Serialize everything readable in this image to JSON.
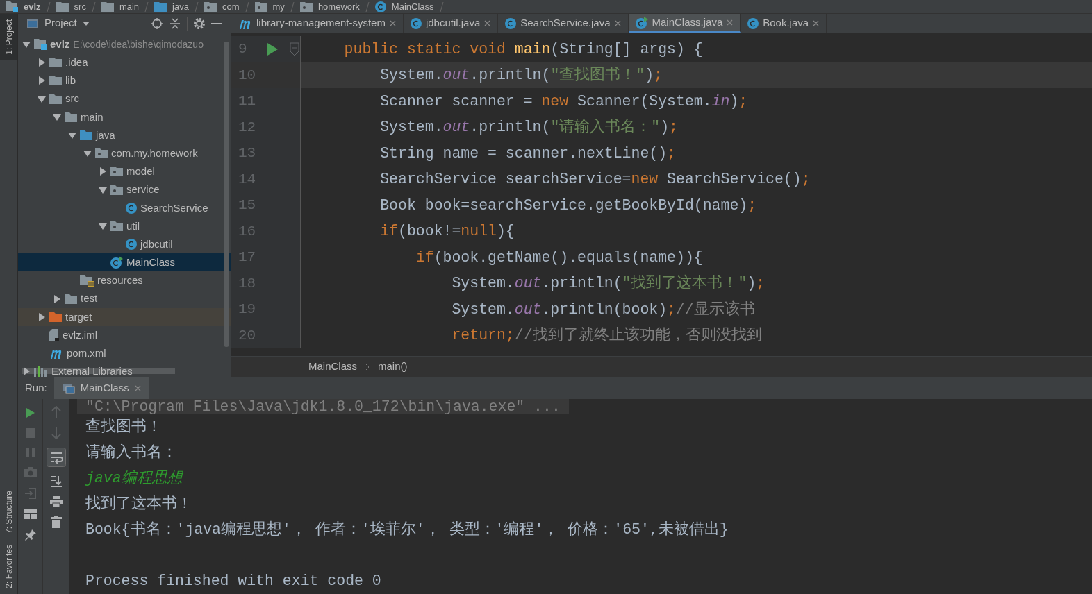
{
  "navbar": [
    {
      "label": "evlz",
      "kind": "module"
    },
    {
      "label": "src",
      "kind": "folder"
    },
    {
      "label": "main",
      "kind": "folder"
    },
    {
      "label": "java",
      "kind": "source"
    },
    {
      "label": "com",
      "kind": "package"
    },
    {
      "label": "my",
      "kind": "package"
    },
    {
      "label": "homework",
      "kind": "package"
    },
    {
      "label": "MainClass",
      "kind": "class"
    }
  ],
  "left_stripe": [
    {
      "label": "1: Project",
      "selected": true
    },
    {
      "label": "7: Structure",
      "selected": false
    },
    {
      "label": "2: Favorites",
      "selected": false
    }
  ],
  "project_panel": {
    "title": "Project",
    "tree": [
      {
        "label": "evlz",
        "path": "E:\\code\\idea\\bishe\\qimodazuo",
        "kind": "module",
        "expanded": true,
        "selected": false,
        "children": [
          {
            "label": ".idea",
            "kind": "folder",
            "expanded": false,
            "selected": false
          },
          {
            "label": "lib",
            "kind": "folder",
            "expanded": false,
            "selected": false
          },
          {
            "label": "src",
            "kind": "folder",
            "expanded": true,
            "selected": false,
            "children": [
              {
                "label": "main",
                "kind": "folder",
                "expanded": true,
                "selected": false,
                "children": [
                  {
                    "label": "java",
                    "kind": "source",
                    "expanded": true,
                    "selected": false,
                    "children": [
                      {
                        "label": "com.my.homework",
                        "kind": "package",
                        "expanded": true,
                        "selected": false,
                        "children": [
                          {
                            "label": "model",
                            "kind": "package",
                            "expanded": false,
                            "selected": false
                          },
                          {
                            "label": "service",
                            "kind": "package",
                            "expanded": true,
                            "selected": false,
                            "children": [
                              {
                                "label": "SearchService",
                                "kind": "class",
                                "selected": false
                              }
                            ]
                          },
                          {
                            "label": "util",
                            "kind": "package",
                            "expanded": true,
                            "selected": false,
                            "children": [
                              {
                                "label": "jdbcutil",
                                "kind": "class",
                                "selected": false
                              }
                            ]
                          },
                          {
                            "label": "MainClass",
                            "kind": "main-class",
                            "selected": true
                          }
                        ]
                      }
                    ]
                  },
                  {
                    "label": "resources",
                    "kind": "resources",
                    "selected": false
                  }
                ]
              },
              {
                "label": "test",
                "kind": "folder",
                "expanded": false,
                "selected": false
              }
            ]
          },
          {
            "label": "target",
            "kind": "excluded",
            "expanded": false,
            "selected": false
          },
          {
            "label": "evlz.iml",
            "kind": "iml",
            "selected": false
          },
          {
            "label": "pom.xml",
            "kind": "maven",
            "selected": false
          }
        ]
      },
      {
        "label": "External Libraries",
        "kind": "libraries",
        "expanded": false,
        "selected": false
      }
    ]
  },
  "editor_tabs": [
    {
      "label": "library-management-system",
      "kind": "maven",
      "selected": false
    },
    {
      "label": "jdbcutil.java",
      "kind": "class",
      "selected": false
    },
    {
      "label": "SearchService.java",
      "kind": "class",
      "selected": false
    },
    {
      "label": "MainClass.java",
      "kind": "main-class",
      "selected": true
    },
    {
      "label": "Book.java",
      "kind": "class",
      "selected": false
    }
  ],
  "code": [
    {
      "number": "9",
      "run_marker": true,
      "current": false,
      "tokens": [
        {
          "t": "    public static void ",
          "kind": "keyword"
        },
        {
          "t": "main",
          "kind": "method"
        },
        {
          "t": "(String[] args) {",
          "kind": "plain"
        }
      ]
    },
    {
      "number": "10",
      "run_marker": false,
      "current": true,
      "tokens": [
        {
          "t": "        System.",
          "kind": "plain"
        },
        {
          "t": "out",
          "kind": "field"
        },
        {
          "t": ".println(",
          "kind": "plain"
        },
        {
          "t": "\"查找图书！\"",
          "kind": "string"
        },
        {
          "t": ")",
          "kind": "plain"
        },
        {
          "t": ";",
          "kind": "keyword"
        }
      ]
    },
    {
      "number": "11",
      "run_marker": false,
      "current": false,
      "tokens": [
        {
          "t": "        Scanner scanner = ",
          "kind": "plain"
        },
        {
          "t": "new",
          "kind": "keyword"
        },
        {
          "t": " Scanner(System.",
          "kind": "plain"
        },
        {
          "t": "in",
          "kind": "field"
        },
        {
          "t": ")",
          "kind": "plain"
        },
        {
          "t": ";",
          "kind": "keyword"
        }
      ]
    },
    {
      "number": "12",
      "run_marker": false,
      "current": false,
      "tokens": [
        {
          "t": "        System.",
          "kind": "plain"
        },
        {
          "t": "out",
          "kind": "field"
        },
        {
          "t": ".println(",
          "kind": "plain"
        },
        {
          "t": "\"请输入书名：\"",
          "kind": "string"
        },
        {
          "t": ")",
          "kind": "plain"
        },
        {
          "t": ";",
          "kind": "keyword"
        }
      ]
    },
    {
      "number": "13",
      "run_marker": false,
      "current": false,
      "tokens": [
        {
          "t": "        String name = scanner.nextLine()",
          "kind": "plain"
        },
        {
          "t": ";",
          "kind": "keyword"
        }
      ]
    },
    {
      "number": "14",
      "run_marker": false,
      "current": false,
      "tokens": [
        {
          "t": "        SearchService searchService=",
          "kind": "plain"
        },
        {
          "t": "new",
          "kind": "keyword"
        },
        {
          "t": " SearchService()",
          "kind": "plain"
        },
        {
          "t": ";",
          "kind": "keyword"
        }
      ]
    },
    {
      "number": "15",
      "run_marker": false,
      "current": false,
      "tokens": [
        {
          "t": "        Book book=searchService.getBookById(name)",
          "kind": "plain"
        },
        {
          "t": ";",
          "kind": "keyword"
        }
      ]
    },
    {
      "number": "16",
      "run_marker": false,
      "current": false,
      "tokens": [
        {
          "t": "        if",
          "kind": "keyword"
        },
        {
          "t": "(book!=",
          "kind": "plain"
        },
        {
          "t": "null",
          "kind": "keyword"
        },
        {
          "t": "){",
          "kind": "plain"
        }
      ]
    },
    {
      "number": "17",
      "run_marker": false,
      "current": false,
      "tokens": [
        {
          "t": "            if",
          "kind": "keyword"
        },
        {
          "t": "(book.getName().equals(name)){",
          "kind": "plain"
        }
      ]
    },
    {
      "number": "18",
      "run_marker": false,
      "current": false,
      "tokens": [
        {
          "t": "                System.",
          "kind": "plain"
        },
        {
          "t": "out",
          "kind": "field"
        },
        {
          "t": ".println(",
          "kind": "plain"
        },
        {
          "t": "\"找到了这本书！\"",
          "kind": "string"
        },
        {
          "t": ")",
          "kind": "plain"
        },
        {
          "t": ";",
          "kind": "keyword"
        }
      ]
    },
    {
      "number": "19",
      "run_marker": false,
      "current": false,
      "tokens": [
        {
          "t": "                System.",
          "kind": "plain"
        },
        {
          "t": "out",
          "kind": "field"
        },
        {
          "t": ".println(book)",
          "kind": "plain"
        },
        {
          "t": ";",
          "kind": "keyword"
        },
        {
          "t": "//显示该书",
          "kind": "comment"
        }
      ]
    },
    {
      "number": "20",
      "run_marker": false,
      "current": false,
      "tokens": [
        {
          "t": "                return;",
          "kind": "keyword"
        },
        {
          "t": "//找到了就终止该功能，否则没找到",
          "kind": "comment"
        }
      ]
    }
  ],
  "editor_breadcrumb": [
    "MainClass",
    "main()"
  ],
  "run_panel": {
    "label": "Run:",
    "tab": "MainClass",
    "console": [
      {
        "text": "\"C:\\Program Files\\Java\\jdk1.8.0_172\\bin\\java.exe\" ...",
        "kind": "command"
      },
      {
        "text": "查找图书！",
        "kind": "output"
      },
      {
        "text": "请输入书名：",
        "kind": "output"
      },
      {
        "text": "java编程思想",
        "kind": "input"
      },
      {
        "text": "找到了这本书！",
        "kind": "output"
      },
      {
        "text": "Book{书名：'java编程思想'， 作者：'埃菲尔'， 类型：'编程'， 价格：'65',未被借出}",
        "kind": "output"
      },
      {
        "text": "Process finished with exit code 0",
        "kind": "exit"
      }
    ]
  }
}
